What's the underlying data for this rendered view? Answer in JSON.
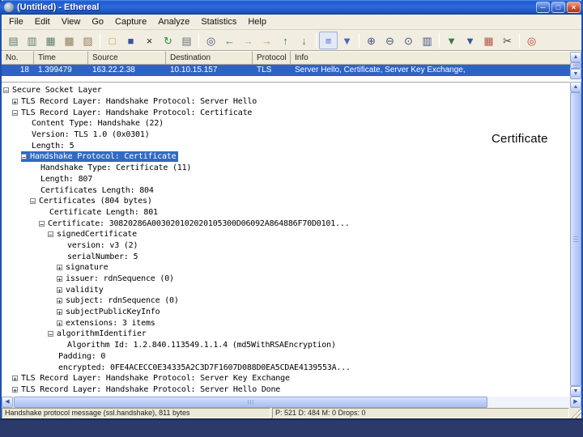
{
  "window": {
    "title": "(Untitled) - Ethereal"
  },
  "menu": {
    "items": [
      "File",
      "Edit",
      "View",
      "Go",
      "Capture",
      "Analyze",
      "Statistics",
      "Help"
    ]
  },
  "toolbar": {
    "icons": [
      {
        "name": "capture-interfaces-icon",
        "glyph": "▤",
        "color": "#5f7d74"
      },
      {
        "name": "capture-options-icon",
        "glyph": "▥",
        "color": "#5f7d74"
      },
      {
        "name": "capture-start-icon",
        "glyph": "▦",
        "color": "#5f7d74"
      },
      {
        "name": "capture-stop-icon",
        "glyph": "▩",
        "color": "#96815f"
      },
      {
        "name": "capture-restart-icon",
        "glyph": "▨",
        "color": "#96815f",
        "sep_after": true
      },
      {
        "name": "open-file-icon",
        "glyph": "□",
        "color": "#c79c2e"
      },
      {
        "name": "save-file-icon",
        "glyph": "■",
        "color": "#35569d"
      },
      {
        "name": "close-capture-icon",
        "glyph": "×",
        "color": "#222222"
      },
      {
        "name": "reload-icon",
        "glyph": "↻",
        "color": "#2f8f3a"
      },
      {
        "name": "print-icon",
        "glyph": "▤",
        "color": "#6a6f7a",
        "sep_after": true
      },
      {
        "name": "find-packet-icon",
        "glyph": "◎",
        "color": "#44527d"
      },
      {
        "name": "go-back-icon",
        "glyph": "←",
        "color": "#2f8f3a"
      },
      {
        "name": "go-forward-icon",
        "glyph": "→",
        "color": "#a3b2a5"
      },
      {
        "name": "go-to-packet-icon",
        "glyph": "→",
        "color": "#c79c2e"
      },
      {
        "name": "go-to-top-icon",
        "glyph": "↑",
        "color": "#2f8f3a"
      },
      {
        "name": "go-to-bottom-icon",
        "glyph": "↓",
        "color": "#2f8f3a",
        "sep_after": true
      },
      {
        "name": "colorize-icon",
        "glyph": "≡",
        "color": "#4466cc",
        "pressed": true
      },
      {
        "name": "auto-scroll-icon",
        "glyph": "▼",
        "color": "#4466cc",
        "sep_after": true
      },
      {
        "name": "zoom-in-icon",
        "glyph": "⊕",
        "color": "#44527d"
      },
      {
        "name": "zoom-out-icon",
        "glyph": "⊖",
        "color": "#44527d"
      },
      {
        "name": "zoom-100-icon",
        "glyph": "⊙",
        "color": "#44527d"
      },
      {
        "name": "resize-columns-icon",
        "glyph": "▥",
        "color": "#44527d",
        "sep_after": true
      },
      {
        "name": "capture-filter-icon",
        "glyph": "▼",
        "color": "#3a7a4a"
      },
      {
        "name": "display-filter-icon",
        "glyph": "▼",
        "color": "#35569d"
      },
      {
        "name": "coloring-rules-icon",
        "glyph": "▦",
        "color": "#b05548"
      },
      {
        "name": "preferences-icon",
        "glyph": "✂",
        "color": "#444444",
        "sep_after": true
      },
      {
        "name": "help-icon",
        "glyph": "◎",
        "color": "#c23b2e"
      }
    ]
  },
  "packet_list": {
    "columns": [
      "No.",
      "Time",
      "Source",
      "Destination",
      "Protocol",
      "Info"
    ],
    "selected_row": {
      "no": "18",
      "time": "1.399479",
      "source": "163.22.2.38",
      "destination": "10.10.15.157",
      "protocol": "TLS",
      "info": "Server Hello, Certificate, Server Key Exchange,"
    }
  },
  "tree": {
    "rows": [
      {
        "level": 0,
        "expander": "minus",
        "text": "Secure Socket Layer"
      },
      {
        "level": 1,
        "expander": "plus",
        "text": "TLS Record Layer: Handshake Protocol: Server Hello"
      },
      {
        "level": 1,
        "expander": "minus",
        "text": "TLS Record Layer: Handshake Protocol: Certificate"
      },
      {
        "level": 2,
        "expander": null,
        "text": "Content Type: Handshake (22)"
      },
      {
        "level": 2,
        "expander": null,
        "text": "Version: TLS 1.0 (0x0301)"
      },
      {
        "level": 2,
        "expander": null,
        "text": "Length: 5"
      },
      {
        "level": 2,
        "expander": "minus",
        "text": "Handshake Protocol: Certificate",
        "selected": true
      },
      {
        "level": 3,
        "expander": null,
        "text": "Handshake Type: Certificate (11)"
      },
      {
        "level": 3,
        "expander": null,
        "text": "Length: 807"
      },
      {
        "level": 3,
        "expander": null,
        "text": "Certificates Length: 804"
      },
      {
        "level": 3,
        "expander": "minus",
        "text": "Certificates (804 bytes)"
      },
      {
        "level": 4,
        "expander": null,
        "text": "Certificate Length: 801"
      },
      {
        "level": 4,
        "expander": "minus",
        "text": "Certificate: 30820286A003020102020105300D06092A864886F70D0101..."
      },
      {
        "level": 5,
        "expander": "minus",
        "text": "signedCertificate"
      },
      {
        "level": 6,
        "expander": null,
        "text": "version: v3 (2)"
      },
      {
        "level": 6,
        "expander": null,
        "text": "serialNumber: 5"
      },
      {
        "level": 6,
        "expander": "plus",
        "text": "signature"
      },
      {
        "level": 6,
        "expander": "plus",
        "text": "issuer: rdnSequence (0)"
      },
      {
        "level": 6,
        "expander": "plus",
        "text": "validity"
      },
      {
        "level": 6,
        "expander": "plus",
        "text": "subject: rdnSequence (0)"
      },
      {
        "level": 6,
        "expander": "plus",
        "text": "subjectPublicKeyInfo"
      },
      {
        "level": 6,
        "expander": "plus",
        "text": "extensions: 3 items"
      },
      {
        "level": 5,
        "expander": "minus",
        "text": "algorithmIdentifier"
      },
      {
        "level": 6,
        "expander": null,
        "text": "Algorithm Id: 1.2.840.113549.1.1.4 (md5WithRSAEncryption)"
      },
      {
        "level": 5,
        "expander": null,
        "text": "Padding: 0"
      },
      {
        "level": 5,
        "expander": null,
        "text": "encrypted: 0FE4ACECC0E34335A2C3D7F1607D088D0EA5CDAE4139553A..."
      },
      {
        "level": 1,
        "expander": "plus",
        "text": "TLS Record Layer: Handshake Protocol: Server Key Exchange"
      },
      {
        "level": 1,
        "expander": "plus",
        "text": "TLS Record Layer: Handshake Protocol: Server Hello Done"
      }
    ]
  },
  "status_bar": {
    "left": "Handshake protocol message (ssl.handshake), 811 bytes",
    "right": "P: 521 D: 484 M: 0 Drops: 0"
  },
  "annotation": {
    "text": "Certificate"
  },
  "colors": {
    "selection": "#316ac5",
    "titlebar": "#2b6ade",
    "chrome": "#ece9d8",
    "slide_background": "#2b3a6b"
  }
}
